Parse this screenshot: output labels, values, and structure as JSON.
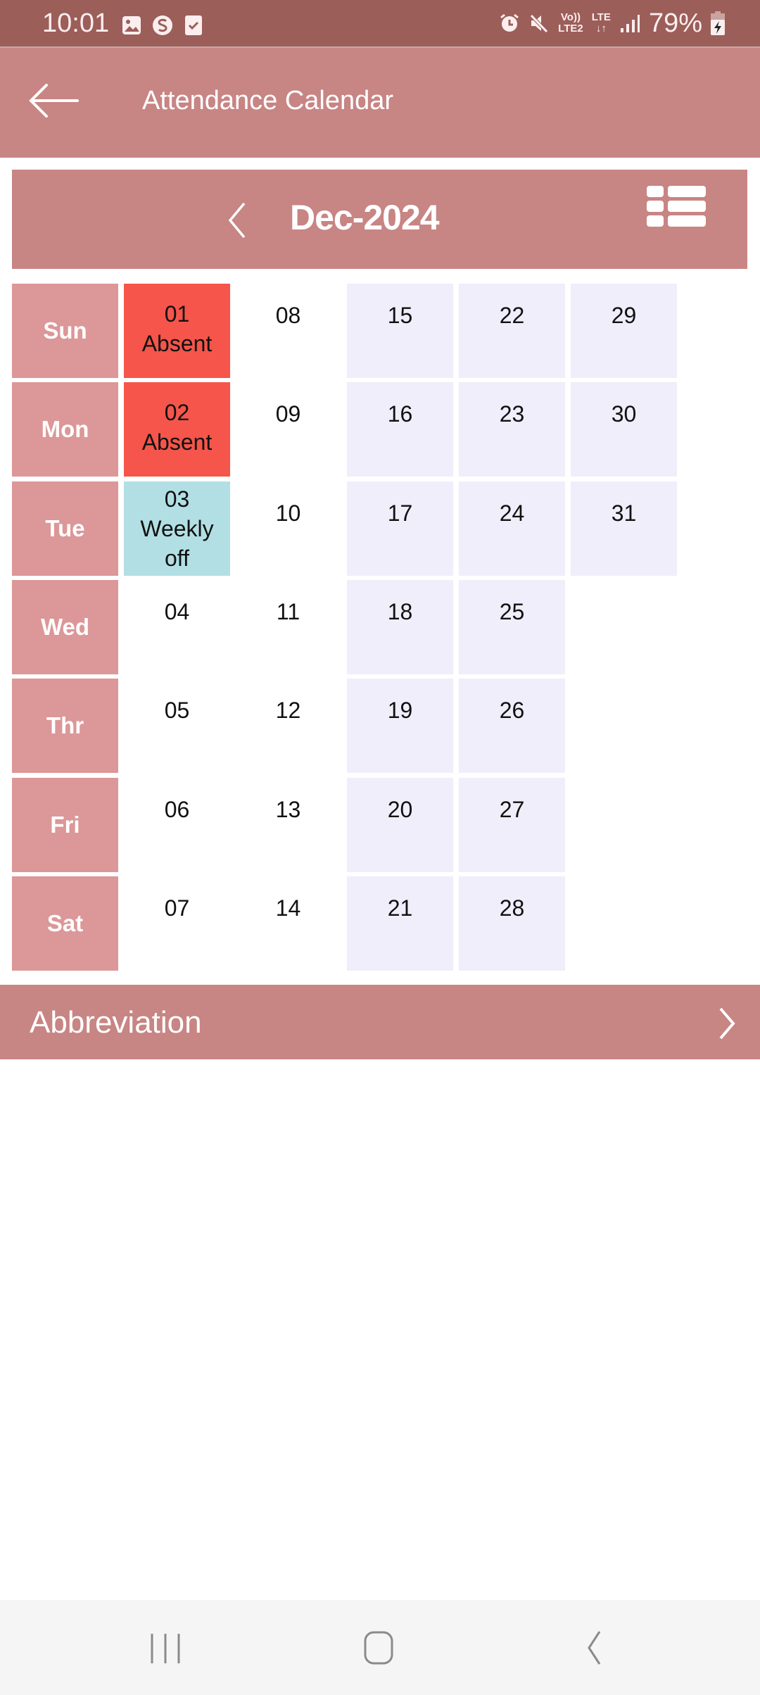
{
  "status_bar": {
    "time": "10:01",
    "left_icons": [
      "gallery-icon",
      "s-app-icon",
      "checkbox-icon"
    ],
    "right_icons": [
      "alarm-icon",
      "mute-icon",
      "volte-icon",
      "lte-data-icon",
      "signal-icon"
    ],
    "volte_top": "Vo))",
    "volte_bottom": "LTE2",
    "lte_top": "LTE",
    "lte_bottom": "↓↑",
    "battery_percent": "79%"
  },
  "app_bar": {
    "back_icon": "arrow-left-icon",
    "title": "Attendance Calendar"
  },
  "month_header": {
    "prev_icon": "chevron-left-icon",
    "month": "Dec-2024",
    "view_toggle_icon": "list-view-icon"
  },
  "calendar": {
    "weekdays": [
      "Sun",
      "Mon",
      "Tue",
      "Wed",
      "Thr",
      "Fri",
      "Sat"
    ],
    "colors": {
      "weekday_label_bg": "#DC9798",
      "absent": "#F5554A",
      "weekly_off": "#B2DFE4",
      "future": "#F0EEFA"
    },
    "weeks": [
      [
        {
          "date": "01",
          "status": "Absent",
          "type": "absent"
        },
        {
          "date": "02",
          "status": "Absent",
          "type": "absent"
        },
        {
          "date": "03",
          "status": "Weekly off",
          "type": "weekoff"
        },
        {
          "date": "04",
          "status": "",
          "type": "plain"
        },
        {
          "date": "05",
          "status": "",
          "type": "plain"
        },
        {
          "date": "06",
          "status": "",
          "type": "plain"
        },
        {
          "date": "07",
          "status": "",
          "type": "plain"
        }
      ],
      [
        {
          "date": "08",
          "status": "",
          "type": "plain"
        },
        {
          "date": "09",
          "status": "",
          "type": "plain"
        },
        {
          "date": "10",
          "status": "",
          "type": "plain"
        },
        {
          "date": "11",
          "status": "",
          "type": "plain"
        },
        {
          "date": "12",
          "status": "",
          "type": "plain"
        },
        {
          "date": "13",
          "status": "",
          "type": "plain"
        },
        {
          "date": "14",
          "status": "",
          "type": "plain"
        }
      ],
      [
        {
          "date": "15",
          "status": "",
          "type": "future"
        },
        {
          "date": "16",
          "status": "",
          "type": "future"
        },
        {
          "date": "17",
          "status": "",
          "type": "future"
        },
        {
          "date": "18",
          "status": "",
          "type": "future"
        },
        {
          "date": "19",
          "status": "",
          "type": "future"
        },
        {
          "date": "20",
          "status": "",
          "type": "future"
        },
        {
          "date": "21",
          "status": "",
          "type": "future"
        }
      ],
      [
        {
          "date": "22",
          "status": "",
          "type": "future"
        },
        {
          "date": "23",
          "status": "",
          "type": "future"
        },
        {
          "date": "24",
          "status": "",
          "type": "future"
        },
        {
          "date": "25",
          "status": "",
          "type": "future"
        },
        {
          "date": "26",
          "status": "",
          "type": "future"
        },
        {
          "date": "27",
          "status": "",
          "type": "future"
        },
        {
          "date": "28",
          "status": "",
          "type": "future"
        }
      ],
      [
        {
          "date": "29",
          "status": "",
          "type": "future"
        },
        {
          "date": "30",
          "status": "",
          "type": "future"
        },
        {
          "date": "31",
          "status": "",
          "type": "future"
        }
      ]
    ]
  },
  "abbreviation": {
    "label": "Abbreviation",
    "icon": "chevron-right-icon"
  },
  "nav_bar": {
    "recents_icon": "recents-icon",
    "home_icon": "home-icon",
    "back_icon": "back-icon"
  }
}
